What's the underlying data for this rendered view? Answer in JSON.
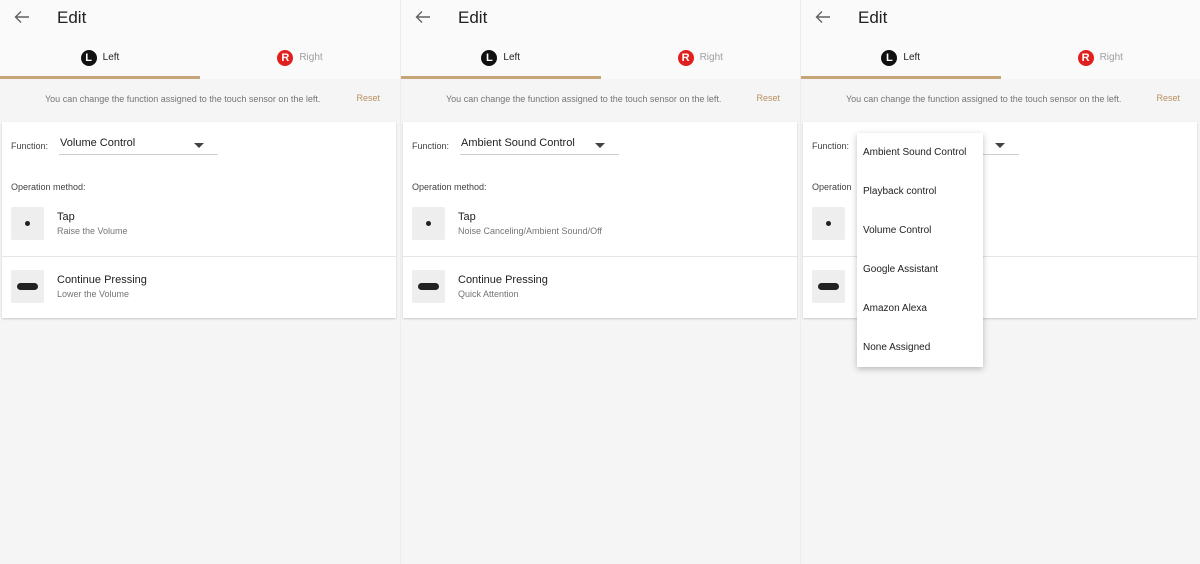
{
  "colors": {
    "accent": "#c6a57a",
    "reset": "#b8915d",
    "left_badge": "#111111",
    "right_badge": "#e0201e"
  },
  "screens": [
    {
      "title": "Edit",
      "tabs": [
        {
          "badge": "L",
          "label": "Left"
        },
        {
          "badge": "R",
          "label": "Right"
        }
      ],
      "info": "You can change the function assigned to the touch sensor on the left.",
      "reset": "Reset",
      "function_label": "Function:",
      "function_value": "Volume Control",
      "operation_label": "Operation method:",
      "tap": {
        "title": "Tap",
        "subtitle": "Raise the Volume"
      },
      "press": {
        "title": "Continue Pressing",
        "subtitle": "Lower the Volume"
      }
    },
    {
      "title": "Edit",
      "tabs": [
        {
          "badge": "L",
          "label": "Left"
        },
        {
          "badge": "R",
          "label": "Right"
        }
      ],
      "info": "You can change the function assigned to the touch sensor on the left.",
      "reset": "Reset",
      "function_label": "Function:",
      "function_value": "Ambient Sound Control",
      "operation_label": "Operation method:",
      "tap": {
        "title": "Tap",
        "subtitle": "Noise Canceling/Ambient Sound/Off"
      },
      "press": {
        "title": "Continue Pressing",
        "subtitle": "Quick Attention"
      }
    },
    {
      "title": "Edit",
      "tabs": [
        {
          "badge": "L",
          "label": "Left"
        },
        {
          "badge": "R",
          "label": "Right"
        }
      ],
      "info": "You can change the function assigned to the touch sensor on the left.",
      "reset": "Reset",
      "function_label": "Function:",
      "function_value": "",
      "operation_label": "Operation",
      "tap": {
        "title": "",
        "subtitle": ""
      },
      "press": {
        "title": "",
        "subtitle": ""
      },
      "dropdown": [
        "Ambient Sound Control",
        "Playback control",
        "Volume Control",
        "Google Assistant",
        "Amazon Alexa",
        "None Assigned"
      ]
    }
  ]
}
